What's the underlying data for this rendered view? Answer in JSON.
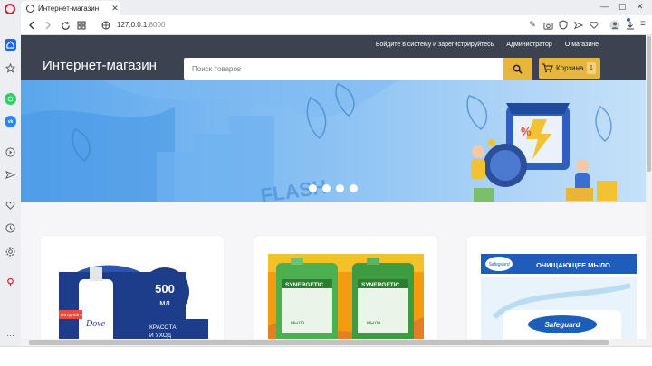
{
  "browser": {
    "tab_title": "Интернет-магазин",
    "tab_close": "✕",
    "window_controls": [
      "—",
      "▢",
      "✕"
    ],
    "url_host": "127.0.0.1",
    "url_port": ":8000",
    "sidebar_icons": [
      "home-icon",
      "star-icon",
      "whatsapp-icon",
      "vk-icon",
      "play-icon",
      "send-icon",
      "heart-icon",
      "history-icon",
      "settings-icon",
      "pin-icon",
      "more-icon"
    ]
  },
  "site": {
    "brand": "Интернет-магазин",
    "top_links": [
      "Войдите в систему и зарегистрируйтесь",
      "Администратор",
      "О магазине"
    ],
    "search_placeholder": "Поиск товаров",
    "cart_label": "Корзина",
    "cart_count": "1",
    "carousel_dots": 4,
    "hero_text": "FLASH"
  },
  "products": [
    {
      "promo_volume": "500",
      "promo_unit": "мл",
      "promo_text": "КРАСОТА И УХОД",
      "brand": "Dove",
      "small_tag": "ВЫГОДНЫЙ ФОРМАТ"
    },
    {
      "brand": "SYNERGETIC",
      "product_label": "мыло"
    },
    {
      "banner": "ОЧИЩАЮЩЕЕ МЫЛО",
      "brand": "Safeguard"
    }
  ],
  "colors": {
    "header": "#3b4351",
    "accent": "#e7b63c",
    "hero": "#5aa6ec"
  }
}
